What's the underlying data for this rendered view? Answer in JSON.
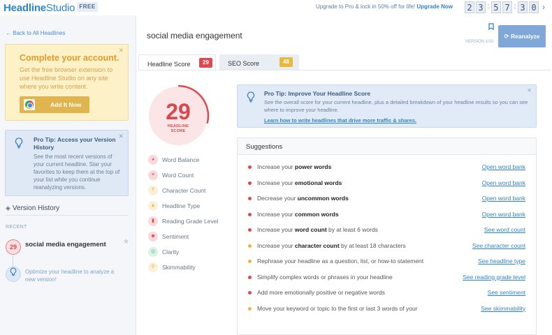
{
  "topbar": {
    "logo_headline": "Headline",
    "logo_studio": "Studio",
    "badge": "FREE",
    "promo_text": "Upgrade to Pro & lock in 50% off for life!",
    "promo_link": "Upgrade Now",
    "countdown": [
      "2",
      "3",
      "5",
      "7",
      "3",
      "0"
    ]
  },
  "sidebar": {
    "back_link": "Back to All Headlines",
    "complete_card": {
      "title": "Complete your account.",
      "desc": "Get the free browser extension to use Headline Studio on any site where you write content.",
      "button": "Add It Now"
    },
    "protip": {
      "title": "Pro Tip: Access your Version History",
      "desc": "See the most recent versions of your current headline. Star your favorites to keep them at the top of your list while you continue reanalyzing versions."
    },
    "version_history": {
      "title": "Version History",
      "recent_label": "RECENT",
      "recent_score": "29",
      "recent_title": "social media engagement",
      "optimize_text": "Optimize your headline to analyze a new version!"
    }
  },
  "main": {
    "headline": "social media engagement",
    "version_label": "VERSION 1/10",
    "reanalyze": "Reanalyze",
    "tabs": [
      {
        "label": "Headline Score",
        "score": "29"
      },
      {
        "label": "SEO Score",
        "score": "48"
      }
    ],
    "score": {
      "value": "29",
      "label_line1": "HEADLINE",
      "label_line2": "SCORE",
      "fraction": 0.29
    },
    "metrics": [
      {
        "label": "Word Balance",
        "icon": "pie-chart-icon",
        "color": "#e0474f"
      },
      {
        "label": "Word Count",
        "icon": "list-icon",
        "color": "#e0474f"
      },
      {
        "label": "Character Count",
        "icon": "letter-t-icon",
        "color": "#e9b83d"
      },
      {
        "label": "Headline Type",
        "icon": "shapes-icon",
        "color": "#e9b83d"
      },
      {
        "label": "Reading Grade Level",
        "icon": "book-icon",
        "color": "#e0474f"
      },
      {
        "label": "Sentiment",
        "icon": "smiley-icon",
        "color": "#e0474f"
      },
      {
        "label": "Clarity",
        "icon": "target-icon",
        "color": "#4bbf86"
      },
      {
        "label": "Skimmability",
        "icon": "magnifier-icon",
        "color": "#e9b83d"
      }
    ],
    "protip": {
      "title": "Pro Tip: Improve Your Headline Score",
      "desc": "See the overall score for your current headline, plus a detailed breakdown of your headline results so you can see where to improve your headline.",
      "link": "Learn how to write headlines that drive more traffic & shares."
    },
    "suggestions": {
      "title": "Suggestions",
      "items": [
        {
          "pre": "Increase your ",
          "bold": "power words",
          "post": "",
          "link": "Open word bank",
          "color": "#e0474f"
        },
        {
          "pre": "Increase your ",
          "bold": "emotional words",
          "post": "",
          "link": "Open word bank",
          "color": "#e0474f"
        },
        {
          "pre": "Decrease your ",
          "bold": "uncommon words",
          "post": "",
          "link": "Open word bank",
          "color": "#e0474f"
        },
        {
          "pre": "Increase your ",
          "bold": "common words",
          "post": "",
          "link": "Open word bank",
          "color": "#e0474f"
        },
        {
          "pre": "Increase your ",
          "bold": "word count",
          "post": " by at least 6 words",
          "link": "See word count",
          "color": "#e0474f"
        },
        {
          "pre": "Increase your ",
          "bold": "character count",
          "post": " by at least 18 characters",
          "link": "See character count",
          "color": "#e9b83d"
        },
        {
          "pre": "Rephrase your headline as a question, list, or how-to statement",
          "bold": "",
          "post": "",
          "link": "See headline type",
          "color": "#e9b83d"
        },
        {
          "pre": "Simplify complex words or phrases in your headline",
          "bold": "",
          "post": "",
          "link": "See reading grade level",
          "color": "#e0474f"
        },
        {
          "pre": "Add more emotionally positive or negative words",
          "bold": "",
          "post": "",
          "link": "See sentiment",
          "color": "#e0474f"
        },
        {
          "pre": "Move your keyword or topic to the first or last 3 words of your",
          "bold": "",
          "post": "",
          "link": "See skimmability",
          "color": "#e9b83d"
        }
      ]
    }
  }
}
